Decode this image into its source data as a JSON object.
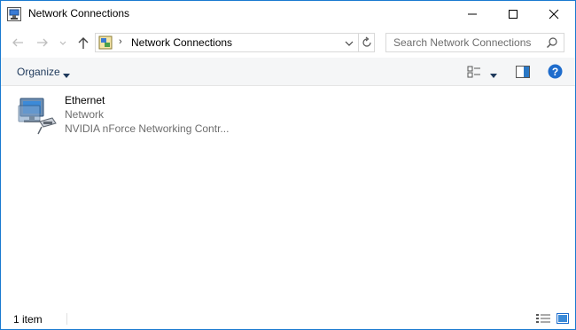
{
  "window": {
    "title": "Network Connections",
    "accent": "#1a7ad0",
    "buttons": [
      "minimize-icon",
      "maximize-icon",
      "close-icon"
    ]
  },
  "nav": {
    "address_text": "Network Connections",
    "address_separator": "›",
    "search_placeholder": "Search Network Connections"
  },
  "toolbar": {
    "organize_label": "Organize",
    "icons": [
      "change-view-icon",
      "preview-pane-icon",
      "help-icon"
    ]
  },
  "items": [
    {
      "name": "Ethernet",
      "network": "Network",
      "device": "NVIDIA nForce Networking Contr..."
    }
  ],
  "status": {
    "count_text": "1 item"
  }
}
